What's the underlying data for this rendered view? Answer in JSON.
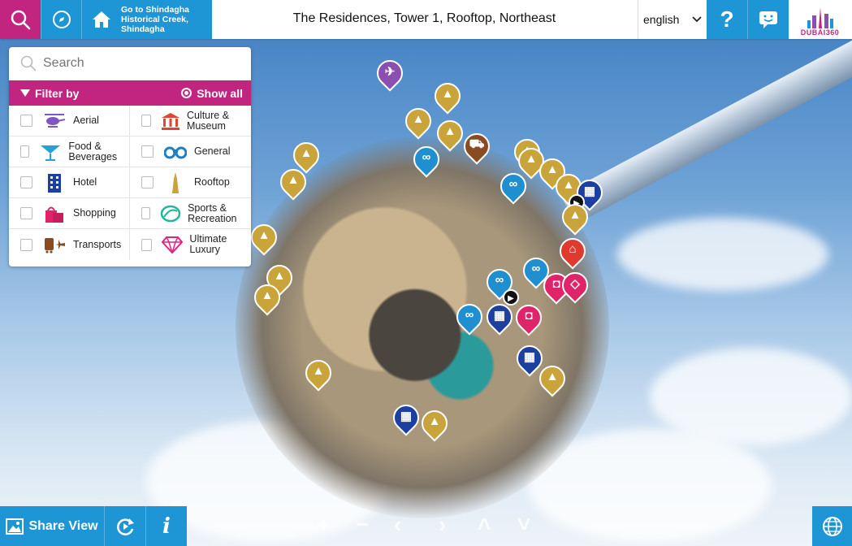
{
  "header": {
    "search_icon": "search-icon",
    "compass_icon": "compass-icon",
    "goto_label": "Go to Shindagha Historical Creek, Shindagha",
    "home_icon": "home-icon",
    "title": "The Residences, Tower 1, Rooftop, Northeast",
    "language": "english",
    "help_label": "?",
    "chat_icon": "chat-icon",
    "logo_text": "DUBAI360"
  },
  "filter_panel": {
    "search_placeholder": "Search",
    "filter_by_label": "Filter by",
    "show_all_label": "Show all",
    "categories": [
      {
        "label": "Aerial",
        "icon": "helicopter-icon",
        "color": "#7e57c2"
      },
      {
        "label": "Culture & Museum",
        "icon": "museum-icon",
        "color": "#e0452f"
      },
      {
        "label": "Food & Beverages",
        "icon": "cocktail-icon",
        "color": "#1fa3d8"
      },
      {
        "label": "General",
        "icon": "binoculars-icon",
        "color": "#1e7fc4"
      },
      {
        "label": "Hotel",
        "icon": "hotel-icon",
        "color": "#1c3fa0"
      },
      {
        "label": "Rooftop",
        "icon": "tower-icon",
        "color": "#c9a43b"
      },
      {
        "label": "Shopping",
        "icon": "shopping-bag-icon",
        "color": "#e0246a"
      },
      {
        "label": "Sports & Recreation",
        "icon": "sports-icon",
        "color": "#25b59a"
      },
      {
        "label": "Transports",
        "icon": "transport-icon",
        "color": "#8a4a22"
      },
      {
        "label": "Ultimate Luxury",
        "icon": "diamond-icon",
        "color": "#e0247f"
      }
    ]
  },
  "bottom": {
    "share_label": "Share View",
    "info_label": "i"
  },
  "colors": {
    "magenta": "#c2257f",
    "blue": "#1e95d4"
  }
}
